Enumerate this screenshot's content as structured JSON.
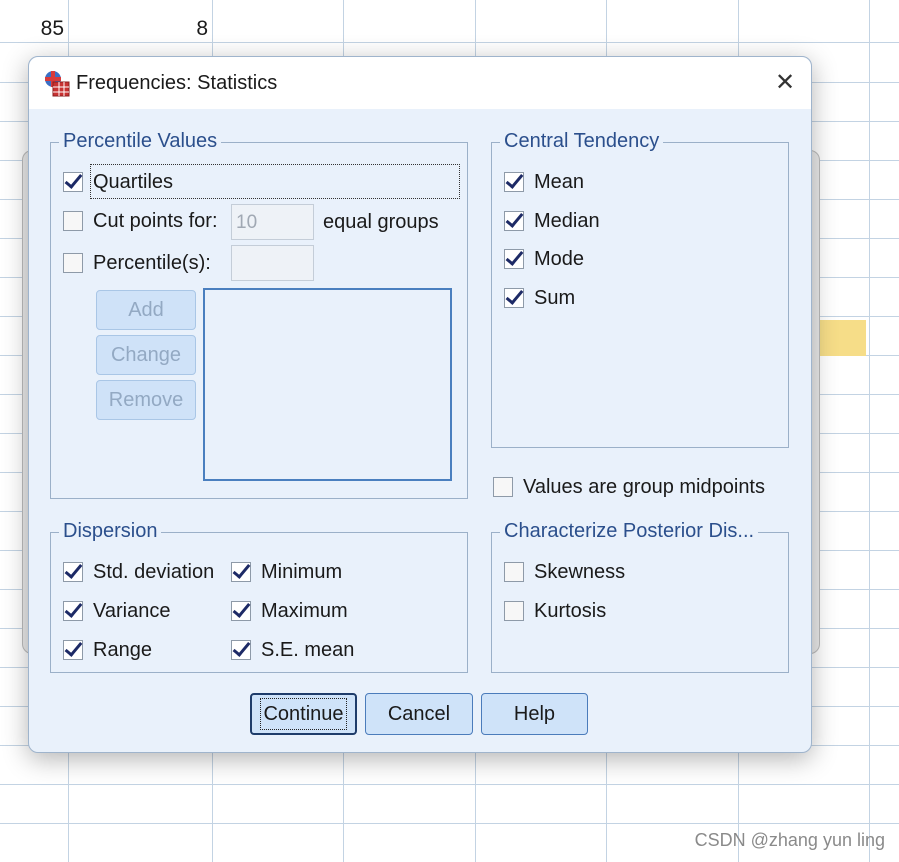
{
  "spreadsheet": {
    "cell_a": "85",
    "cell_b": "8"
  },
  "watermark": "CSDN @zhang yun ling",
  "dialog": {
    "title": "Frequencies: Statistics",
    "close_glyph": "✕",
    "app_icon": "spss-table-icon",
    "percentile_values": {
      "legend": "Percentile Values",
      "quartiles": {
        "label": "Quartiles",
        "checked": true
      },
      "cut_points": {
        "label": "Cut points for:",
        "checked": false,
        "value": "10",
        "suffix": "equal groups"
      },
      "percentiles": {
        "label": "Percentile(s):",
        "checked": false,
        "value": ""
      },
      "buttons": {
        "add": "Add",
        "change": "Change",
        "remove": "Remove"
      }
    },
    "central_tendency": {
      "legend": "Central Tendency",
      "items": [
        {
          "label": "Mean",
          "checked": true
        },
        {
          "label": "Median",
          "checked": true
        },
        {
          "label": "Mode",
          "checked": true
        },
        {
          "label": "Sum",
          "checked": true
        }
      ]
    },
    "group_midpoints": {
      "label": "Values are group midpoints",
      "checked": false
    },
    "dispersion": {
      "legend": "Dispersion",
      "items": [
        {
          "label": "Std. deviation",
          "checked": true
        },
        {
          "label": "Minimum",
          "checked": true
        },
        {
          "label": "Variance",
          "checked": true
        },
        {
          "label": "Maximum",
          "checked": true
        },
        {
          "label": "Range",
          "checked": true
        },
        {
          "label": "S.E. mean",
          "checked": true
        }
      ]
    },
    "posterior": {
      "legend": "Characterize Posterior Dis...",
      "items": [
        {
          "label": "Skewness",
          "checked": false
        },
        {
          "label": "Kurtosis",
          "checked": false
        }
      ]
    },
    "buttons": {
      "continue": "Continue",
      "cancel": "Cancel",
      "help": "Help"
    }
  }
}
